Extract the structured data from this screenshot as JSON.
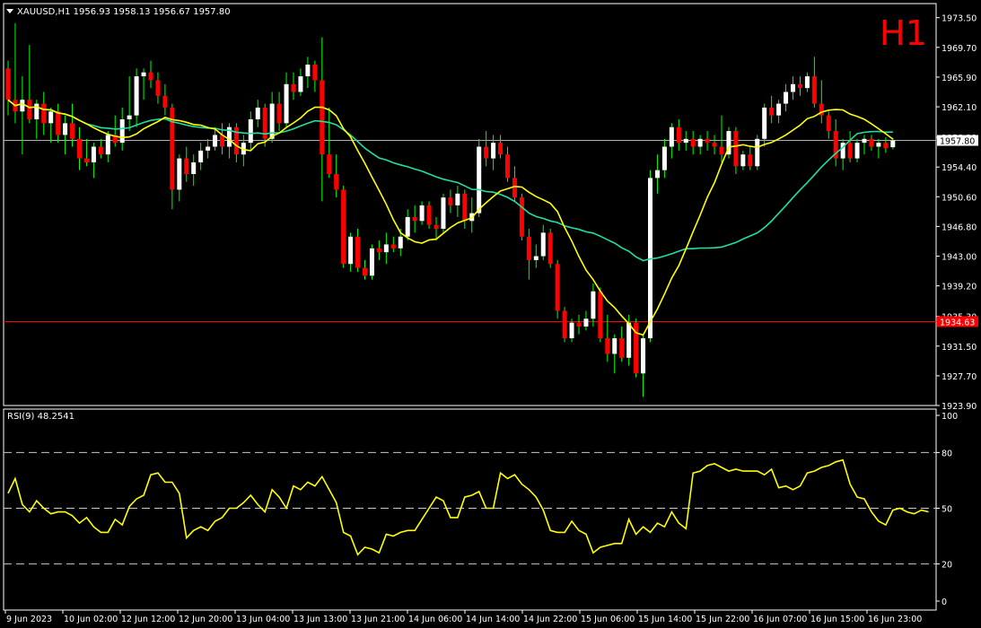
{
  "header": {
    "symbol_info": "XAUUSD,H1  1956.93 1958.13 1956.67 1957.80",
    "timeframe": "H1",
    "dropdown_icon": "triangle-down-icon"
  },
  "colors": {
    "background": "#000000",
    "frame": "#ffffff",
    "bull": "#ffffff",
    "bear": "#ff0000",
    "wick": "#00ff00",
    "ma_fast": "#ffff00",
    "ma_slow": "#20e0a0",
    "rsi": "#ffff00",
    "price_line": "#b0b0b0",
    "support_line": "#ff0000",
    "timeframe_label": "#ff0000"
  },
  "chart_data": [
    {
      "type": "candlestick",
      "title": "XAUUSD,H1",
      "ylim": [
        1923.9,
        1975.3
      ],
      "y_ticks": [
        "1973.50",
        "1969.70",
        "1965.90",
        "1962.10",
        "1958.20",
        "1954.40",
        "1950.60",
        "1946.80",
        "1943.00",
        "1939.20",
        "1935.30",
        "1931.50",
        "1927.70",
        "1923.90"
      ],
      "x_ticks": [
        "9 Jun 2023",
        "10 Jun 02:00",
        "12 Jun 12:00",
        "12 Jun 20:00",
        "13 Jun 04:00",
        "13 Jun 13:00",
        "13 Jun 21:00",
        "14 Jun 06:00",
        "14 Jun 14:00",
        "14 Jun 22:00",
        "15 Jun 06:00",
        "15 Jun 14:00",
        "15 Jun 22:00",
        "16 Jun 07:00",
        "16 Jun 15:00",
        "16 Jun 23:00"
      ],
      "current_price": {
        "value": 1957.8,
        "label": "1957.80"
      },
      "horizontal_line": {
        "value": 1934.63,
        "label": "1934.63"
      },
      "candles": [
        [
          1967.0,
          1968.0,
          1961.0,
          1963.0
        ],
        [
          1963.0,
          1972.8,
          1960.0,
          1961.5
        ],
        [
          1961.5,
          1966.0,
          1956.0,
          1963.0
        ],
        [
          1963.0,
          1970.0,
          1960.0,
          1960.5
        ],
        [
          1960.5,
          1963.0,
          1958.0,
          1962.5
        ],
        [
          1962.5,
          1964.0,
          1958.5,
          1960.0
        ],
        [
          1960.0,
          1962.0,
          1957.5,
          1961.5
        ],
        [
          1961.5,
          1962.5,
          1957.5,
          1958.5
        ],
        [
          1958.5,
          1961.0,
          1956.0,
          1960.0
        ],
        [
          1960.0,
          1962.5,
          1957.0,
          1958.0
        ],
        [
          1958.0,
          1959.5,
          1954.0,
          1955.5
        ],
        [
          1955.5,
          1958.0,
          1954.5,
          1955.0
        ],
        [
          1955.0,
          1957.5,
          1953.0,
          1957.0
        ],
        [
          1957.0,
          1958.0,
          1955.5,
          1956.0
        ],
        [
          1956.0,
          1959.0,
          1955.0,
          1958.5
        ],
        [
          1958.5,
          1961.0,
          1957.0,
          1957.5
        ],
        [
          1957.5,
          1962.0,
          1956.5,
          1960.5
        ],
        [
          1960.5,
          1966.0,
          1959.0,
          1961.0
        ],
        [
          1961.0,
          1967.0,
          1959.5,
          1966.0
        ],
        [
          1966.0,
          1967.0,
          1963.0,
          1966.5
        ],
        [
          1966.5,
          1968.0,
          1964.5,
          1965.5
        ],
        [
          1965.5,
          1966.5,
          1962.5,
          1963.5
        ],
        [
          1963.5,
          1965.0,
          1961.0,
          1962.0
        ],
        [
          1962.0,
          1962.5,
          1949.0,
          1951.5
        ],
        [
          1951.5,
          1956.0,
          1950.0,
          1955.5
        ],
        [
          1955.5,
          1957.0,
          1952.5,
          1953.5
        ],
        [
          1953.5,
          1956.0,
          1952.0,
          1955.0
        ],
        [
          1955.0,
          1957.5,
          1954.0,
          1956.5
        ],
        [
          1956.5,
          1958.0,
          1955.5,
          1957.0
        ],
        [
          1957.0,
          1959.5,
          1956.5,
          1958.5
        ],
        [
          1958.5,
          1960.0,
          1956.0,
          1957.0
        ],
        [
          1957.0,
          1960.0,
          1955.5,
          1959.5
        ],
        [
          1959.5,
          1960.0,
          1955.0,
          1956.0
        ],
        [
          1956.0,
          1958.5,
          1954.5,
          1957.5
        ],
        [
          1957.5,
          1961.5,
          1956.5,
          1960.5
        ],
        [
          1960.5,
          1963.0,
          1959.5,
          1962.0
        ],
        [
          1962.0,
          1962.5,
          1957.0,
          1958.0
        ],
        [
          1958.0,
          1964.0,
          1957.5,
          1962.5
        ],
        [
          1962.5,
          1964.0,
          1959.0,
          1960.0
        ],
        [
          1960.0,
          1966.5,
          1959.5,
          1965.0
        ],
        [
          1965.0,
          1966.5,
          1963.0,
          1964.0
        ],
        [
          1964.0,
          1967.0,
          1963.5,
          1966.0
        ],
        [
          1966.0,
          1968.5,
          1964.5,
          1967.5
        ],
        [
          1967.5,
          1968.0,
          1964.0,
          1965.5
        ],
        [
          1965.5,
          1971.0,
          1950.0,
          1956.0
        ],
        [
          1956.0,
          1962.0,
          1953.0,
          1953.5
        ],
        [
          1953.5,
          1956.0,
          1950.5,
          1951.5
        ],
        [
          1951.5,
          1952.0,
          1941.5,
          1942.0
        ],
        [
          1942.0,
          1946.0,
          1941.0,
          1945.5
        ],
        [
          1945.5,
          1946.5,
          1941.0,
          1941.5
        ],
        [
          1941.5,
          1942.5,
          1940.0,
          1940.5
        ],
        [
          1940.5,
          1944.5,
          1940.0,
          1944.0
        ],
        [
          1944.0,
          1945.0,
          1942.5,
          1943.5
        ],
        [
          1943.5,
          1946.0,
          1942.0,
          1944.5
        ],
        [
          1944.5,
          1945.5,
          1943.5,
          1944.0
        ],
        [
          1944.0,
          1946.5,
          1943.0,
          1945.5
        ],
        [
          1945.5,
          1949.0,
          1945.0,
          1948.0
        ],
        [
          1948.0,
          1949.5,
          1946.0,
          1947.5
        ],
        [
          1947.5,
          1950.0,
          1947.0,
          1949.5
        ],
        [
          1949.5,
          1950.0,
          1946.5,
          1947.0
        ],
        [
          1947.0,
          1948.0,
          1945.0,
          1946.5
        ],
        [
          1946.5,
          1951.0,
          1946.0,
          1950.5
        ],
        [
          1950.5,
          1951.5,
          1948.5,
          1949.5
        ],
        [
          1949.5,
          1952.0,
          1948.0,
          1951.0
        ],
        [
          1951.0,
          1951.5,
          1946.5,
          1947.5
        ],
        [
          1947.5,
          1950.5,
          1946.0,
          1948.5
        ],
        [
          1948.5,
          1958.0,
          1948.0,
          1957.0
        ],
        [
          1957.0,
          1959.0,
          1954.5,
          1955.5
        ],
        [
          1955.5,
          1958.5,
          1954.0,
          1957.5
        ],
        [
          1957.5,
          1958.5,
          1955.5,
          1956.0
        ],
        [
          1956.0,
          1957.0,
          1952.5,
          1953.0
        ],
        [
          1953.0,
          1954.5,
          1950.0,
          1950.5
        ],
        [
          1950.5,
          1951.0,
          1945.0,
          1945.5
        ],
        [
          1945.5,
          1946.5,
          1940.0,
          1942.5
        ],
        [
          1942.5,
          1944.5,
          1941.5,
          1943.0
        ],
        [
          1943.0,
          1947.0,
          1942.5,
          1946.0
        ],
        [
          1946.0,
          1946.5,
          1941.5,
          1942.0
        ],
        [
          1942.0,
          1942.5,
          1935.0,
          1936.0
        ],
        [
          1936.0,
          1936.5,
          1932.0,
          1932.5
        ],
        [
          1932.5,
          1935.0,
          1932.0,
          1934.5
        ],
        [
          1934.5,
          1935.5,
          1933.0,
          1934.0
        ],
        [
          1934.0,
          1936.0,
          1933.5,
          1935.0
        ],
        [
          1935.0,
          1939.5,
          1934.0,
          1938.5
        ],
        [
          1938.5,
          1939.0,
          1932.0,
          1932.5
        ],
        [
          1932.5,
          1935.5,
          1929.5,
          1930.5
        ],
        [
          1930.5,
          1933.0,
          1928.0,
          1932.5
        ],
        [
          1932.5,
          1934.0,
          1929.5,
          1930.0
        ],
        [
          1930.0,
          1935.5,
          1929.0,
          1934.5
        ],
        [
          1934.5,
          1935.0,
          1927.5,
          1928.0
        ],
        [
          1928.0,
          1933.0,
          1925.0,
          1932.5
        ],
        [
          1932.5,
          1954.0,
          1932.0,
          1953.0
        ],
        [
          1953.0,
          1956.0,
          1951.0,
          1954.0
        ],
        [
          1954.0,
          1958.0,
          1953.0,
          1957.0
        ],
        [
          1957.0,
          1960.0,
          1955.5,
          1959.5
        ],
        [
          1959.5,
          1960.5,
          1956.5,
          1957.5
        ],
        [
          1957.5,
          1959.0,
          1956.5,
          1958.0
        ],
        [
          1958.0,
          1959.0,
          1956.0,
          1957.0
        ],
        [
          1957.0,
          1958.5,
          1956.0,
          1958.0
        ],
        [
          1958.0,
          1959.0,
          1956.5,
          1957.5
        ],
        [
          1957.5,
          1958.5,
          1956.0,
          1957.0
        ],
        [
          1957.0,
          1961.0,
          1955.0,
          1956.0
        ],
        [
          1956.0,
          1959.5,
          1955.5,
          1959.0
        ],
        [
          1959.0,
          1959.5,
          1953.5,
          1954.5
        ],
        [
          1954.5,
          1956.5,
          1954.0,
          1956.0
        ],
        [
          1956.0,
          1957.0,
          1954.0,
          1954.5
        ],
        [
          1954.5,
          1958.5,
          1954.0,
          1958.0
        ],
        [
          1958.0,
          1962.5,
          1957.0,
          1962.0
        ],
        [
          1962.0,
          1963.5,
          1960.0,
          1961.0
        ],
        [
          1961.0,
          1963.0,
          1960.0,
          1962.5
        ],
        [
          1962.5,
          1965.0,
          1961.5,
          1964.0
        ],
        [
          1964.0,
          1966.0,
          1963.0,
          1965.0
        ],
        [
          1965.0,
          1966.0,
          1963.5,
          1964.5
        ],
        [
          1964.5,
          1966.5,
          1964.0,
          1966.0
        ],
        [
          1966.0,
          1968.5,
          1962.0,
          1962.5
        ],
        [
          1962.5,
          1965.5,
          1960.0,
          1961.0
        ],
        [
          1961.0,
          1961.5,
          1958.0,
          1959.0
        ],
        [
          1959.0,
          1960.5,
          1954.5,
          1955.5
        ],
        [
          1955.5,
          1958.0,
          1954.0,
          1957.5
        ],
        [
          1957.5,
          1959.0,
          1955.0,
          1955.5
        ],
        [
          1955.5,
          1958.0,
          1955.0,
          1957.5
        ],
        [
          1957.5,
          1958.5,
          1956.0,
          1958.0
        ],
        [
          1958.0,
          1958.5,
          1956.5,
          1957.0
        ],
        [
          1957.0,
          1958.0,
          1955.5,
          1957.5
        ],
        [
          1957.5,
          1958.2,
          1956.2,
          1956.8
        ],
        [
          1956.93,
          1958.13,
          1956.67,
          1957.8
        ]
      ]
    },
    {
      "type": "line",
      "title": "RSI(9) 48.2541",
      "ylim": [
        0,
        100
      ],
      "y_ticks": [
        "100",
        "80",
        "50",
        "20",
        "0"
      ],
      "levels": [
        80,
        50,
        20
      ],
      "series": [
        {
          "values": [
            58,
            66,
            52,
            48,
            54,
            50,
            47,
            48,
            48,
            46,
            42,
            45,
            40,
            37,
            37,
            44,
            41,
            51,
            55,
            57,
            68,
            69,
            64,
            64,
            58,
            34,
            38,
            40,
            38,
            43,
            45,
            50,
            50,
            53,
            57,
            52,
            48,
            60,
            56,
            50,
            62,
            60,
            64,
            62,
            67,
            60,
            53,
            37,
            35,
            25,
            29,
            28,
            26,
            36,
            35,
            37,
            38,
            38,
            44,
            50,
            56,
            54,
            45,
            45,
            56,
            57,
            59,
            50,
            50,
            69,
            66,
            68,
            63,
            60,
            56,
            49,
            38,
            37,
            37,
            43,
            38,
            36,
            26,
            29,
            30,
            31,
            31,
            44,
            36,
            40,
            37,
            42,
            40,
            48,
            42,
            39,
            69,
            70,
            73,
            74,
            72,
            70,
            71,
            70,
            70,
            70,
            68,
            71,
            61,
            62,
            60,
            62,
            69,
            70,
            72,
            73,
            75,
            76,
            63,
            56,
            55,
            48,
            43,
            41,
            49,
            50,
            48,
            47,
            49,
            48
          ]
        }
      ]
    }
  ]
}
